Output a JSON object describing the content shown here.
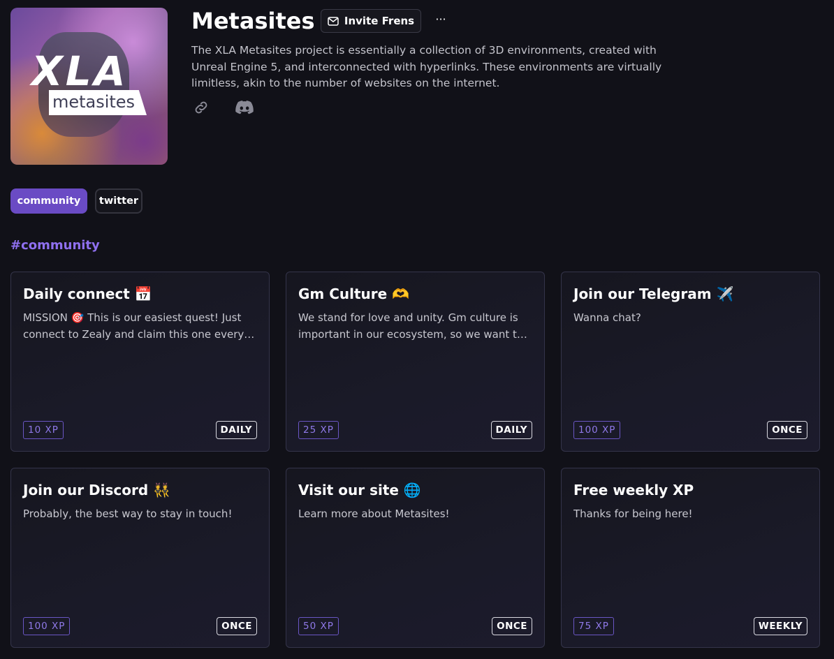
{
  "project": {
    "logo_text": "XLA",
    "logo_subtext": "metasites",
    "title": "Metasites",
    "invite_label": "Invite Frens",
    "more_label": "···",
    "description": "The XLA Metasites project is essentially a collection of 3D environments, created with Unreal Engine 5, and interconnected with hyperlinks. These environments are virtually limitless, akin to the number of websites on the internet.",
    "social_icons": [
      "link-icon",
      "discord-icon"
    ]
  },
  "tags": [
    {
      "label": "community",
      "active": true
    },
    {
      "label": "twitter",
      "active": false
    }
  ],
  "section": {
    "title": "#community"
  },
  "quests": [
    {
      "title": "Daily connect 📅",
      "description": "MISSION 🎯 This is our easiest quest! Just connect to Zealy and claim this one every day.",
      "xp": "10 XP",
      "frequency": "DAILY"
    },
    {
      "title": "Gm Culture 🫶",
      "description": "We stand for love and unity. Gm culture is important in our ecosystem, so we want to see it every day.",
      "xp": "25 XP",
      "frequency": "DAILY"
    },
    {
      "title": "Join our Telegram ✈️",
      "description": "Wanna chat?",
      "xp": "100 XP",
      "frequency": "ONCE"
    },
    {
      "title": "Join our Discord 👯",
      "description": "Probably, the best way to stay in touch!",
      "xp": "100 XP",
      "frequency": "ONCE"
    },
    {
      "title": "Visit our site 🌐",
      "description": "Learn more about Metasites!",
      "xp": "50 XP",
      "frequency": "ONCE"
    },
    {
      "title": "Free weekly XP",
      "description": "Thanks for being here!",
      "xp": "75 XP",
      "frequency": "WEEKLY"
    }
  ],
  "colors": {
    "background": "#111118",
    "accent": "#6a4bc4",
    "accent_text": "#8f70f0",
    "card_border": "#34344a"
  }
}
